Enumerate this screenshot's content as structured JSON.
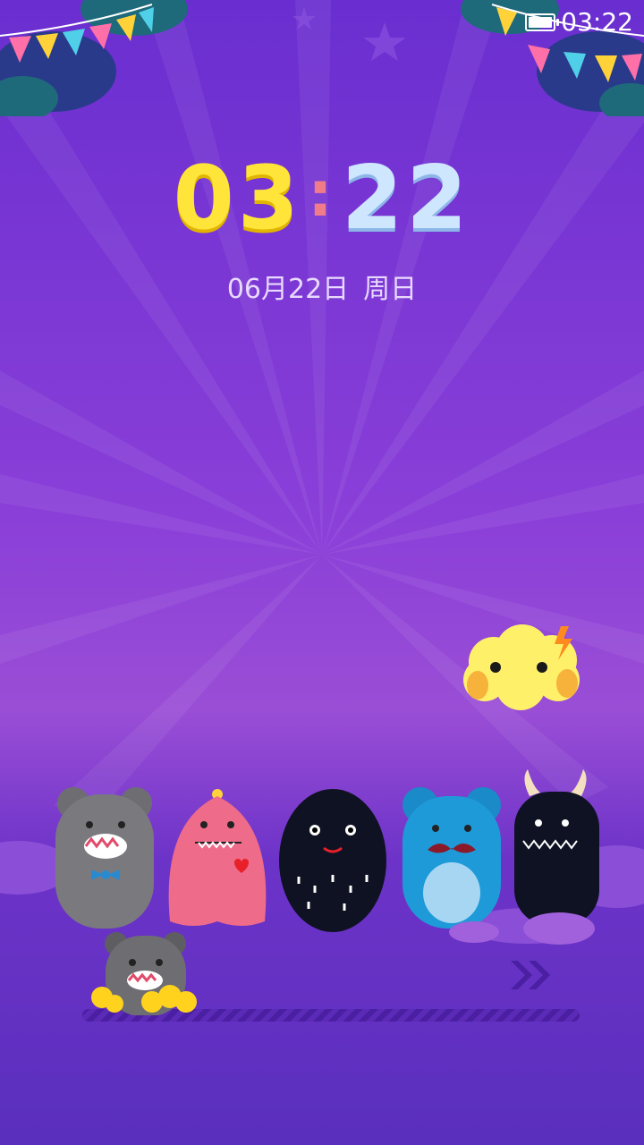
{
  "status_bar": {
    "time": "03:22",
    "battery_icon": "battery-icon"
  },
  "clock": {
    "hours": "03",
    "separator": ":",
    "minutes": "22"
  },
  "date": {
    "day": "06月22日",
    "weekday": "周日"
  },
  "unlock": {
    "arrow_icon": "double-chevron-right-icon"
  },
  "colors": {
    "background": "#7a38d2",
    "hours": "#ffe43a",
    "minutes": "#cfe6ff",
    "separator": "#f07c8a"
  }
}
